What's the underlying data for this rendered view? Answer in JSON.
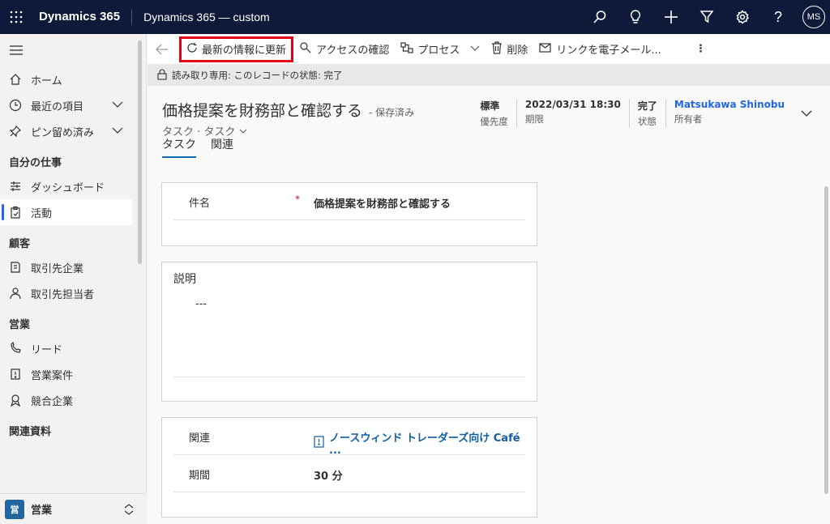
{
  "topbar": {
    "brand": "Dynamics 365",
    "app_name": "Dynamics 365 — custom",
    "icons": [
      "search-icon",
      "lightbulb-icon",
      "plus-icon",
      "filter-icon",
      "gear-icon",
      "help-icon"
    ],
    "avatar_initials": "MS"
  },
  "sidebar": {
    "top_items": [
      {
        "label": "ホーム",
        "icon": "home-icon"
      },
      {
        "label": "最近の項目",
        "icon": "clock-icon"
      },
      {
        "label": "ピン留め済み",
        "icon": "pin-icon"
      }
    ],
    "sections": [
      {
        "title": "自分の仕事",
        "items": [
          {
            "label": "ダッシュボード"
          },
          {
            "label": "活動"
          }
        ]
      },
      {
        "title": "顧客",
        "items": [
          {
            "label": "取引先企業"
          },
          {
            "label": "取引先担当者"
          }
        ]
      },
      {
        "title": "営業",
        "items": [
          {
            "label": "リード"
          },
          {
            "label": "営業案件"
          },
          {
            "label": "競合企業"
          }
        ]
      },
      {
        "title": "関連資料",
        "items": []
      }
    ],
    "area": {
      "badge": "営",
      "label": "営業"
    }
  },
  "commandbar": {
    "refresh": "最新の情報に更新",
    "access": "アクセスの確認",
    "process": "プロセス",
    "delete": "削除",
    "email_link": "リンクを電子メール..."
  },
  "readonly_notice": "読み取り専用: このレコードの状態: 完了",
  "record": {
    "title": "価格提案を財務部と確認する",
    "saved_status": "- 保存済み",
    "entity": "タスク · タスク",
    "header_fields": [
      {
        "value": "標準",
        "label": "優先度"
      },
      {
        "value": "2022/03/31 18:30",
        "label": "期限"
      },
      {
        "value": "完了",
        "label": "状態"
      },
      {
        "value": "Matsukawa Shinobu",
        "label": "所有者"
      }
    ]
  },
  "tabs": [
    "タスク",
    "関連"
  ],
  "form": {
    "subject_label": "件名",
    "required_mark": "*",
    "subject_value": "価格提案を財務部と確認する",
    "description_title": "説明",
    "description_value": "---",
    "regarding_label": "関連",
    "regarding_value": "ノースウィンド トレーダーズ向け Café ...",
    "duration_label": "期間",
    "duration_value": "30 分"
  }
}
